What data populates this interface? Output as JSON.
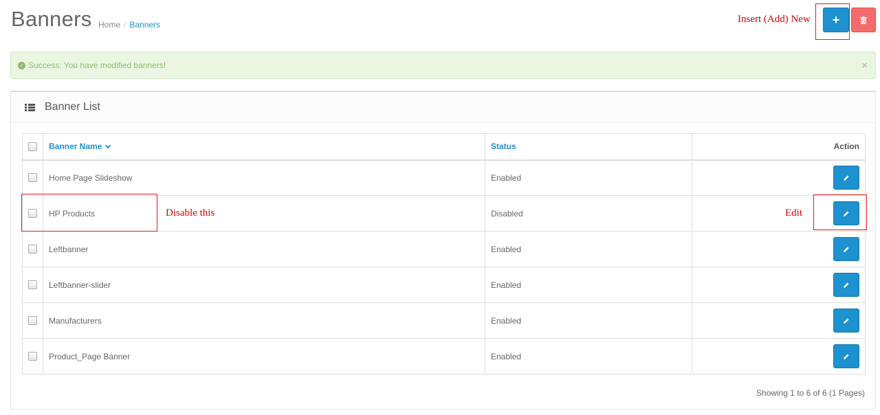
{
  "page": {
    "title": "Banners"
  },
  "breadcrumb": {
    "home": "Home",
    "separator": "/",
    "current": "Banners"
  },
  "toolbar": {
    "add_icon": "plus-icon",
    "delete_icon": "trash-icon"
  },
  "alert": {
    "message": "Success: You have modified banners!",
    "close": "×"
  },
  "panel": {
    "title": "Banner List"
  },
  "table": {
    "headers": {
      "name": "Banner Name",
      "status": "Status",
      "action": "Action"
    },
    "rows": [
      {
        "name": "Home Page Slideshow",
        "status": "Enabled"
      },
      {
        "name": "HP Products",
        "status": "Disabled"
      },
      {
        "name": "Leftbanner",
        "status": "Enabled"
      },
      {
        "name": "Leftbanner-slider",
        "status": "Enabled"
      },
      {
        "name": "Manufacturers",
        "status": "Enabled"
      },
      {
        "name": "Product_Page Banner",
        "status": "Enabled"
      }
    ]
  },
  "pagination": {
    "info": "Showing 1 to 6 of 6 (1 Pages)"
  },
  "annotations": {
    "insert": "Insert (Add)  New",
    "disable": "Disable this",
    "edit": "Edit"
  },
  "colors": {
    "primary": "#1e91cf",
    "danger": "#f56b6b",
    "success_bg": "#eaf6e2",
    "success_text": "#8fbb6c",
    "annotation": "#d40000"
  }
}
